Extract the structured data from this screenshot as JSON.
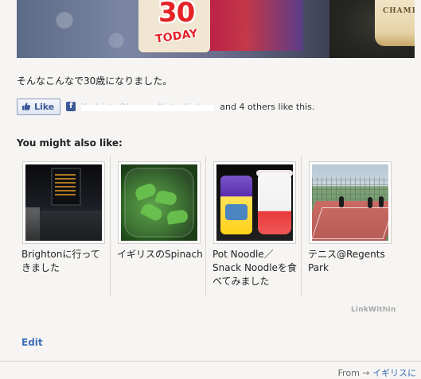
{
  "hero": {
    "card_number": "30",
    "card_text": "TODAY",
    "bottle_label": "CHAMPA"
  },
  "post": {
    "caption": "そんなこんなで30歳になりました。"
  },
  "like": {
    "button_label": "Like",
    "names_redacted": "Yoshiaki Ohsuga, Naho Kudo",
    "suffix": "and 4 others like this."
  },
  "related": {
    "heading": "You might also like:",
    "items": [
      {
        "label": "Brightonに行ってきました"
      },
      {
        "label": "イギリスのSpinach"
      },
      {
        "label": "Pot Noodle／Snack Noodleを食べてみました"
      },
      {
        "label": "テニス@Regents Park"
      }
    ],
    "credit": "LinkWithin"
  },
  "actions": {
    "edit": "Edit"
  },
  "footer": {
    "from_prefix": "From →",
    "from_link": "イギリスに"
  },
  "colors": {
    "page_bg": "#f6f5f3",
    "link_blue": "#3f6db7",
    "facebook_blue": "#3b5998",
    "divider": "#d8d6d2"
  }
}
